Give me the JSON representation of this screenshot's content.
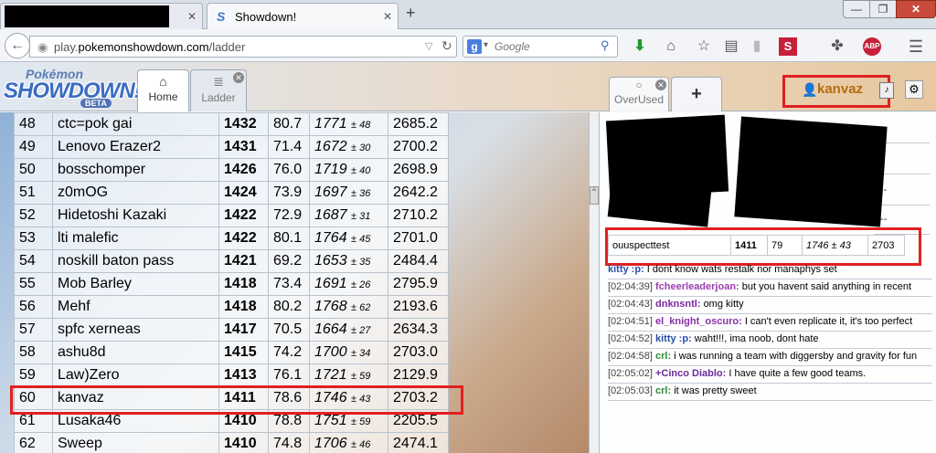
{
  "browser": {
    "tabs": [
      {
        "title": "",
        "redacted": true
      },
      {
        "title": "Showdown!",
        "active": true
      }
    ],
    "new_tab_icon": "+",
    "url_prefix": "play.",
    "url_domain": "pokemonshowdown.com",
    "url_path": "/ladder",
    "search_placeholder": "Google",
    "toolbar_icons": [
      "download-icon",
      "home-icon",
      "bookmark-star-icon",
      "reading-list-icon",
      "stats-icon",
      "s-extension-icon",
      "extensions-icon",
      "adblock-icon",
      "menu-icon"
    ]
  },
  "header": {
    "logo_top": "Pokémon",
    "logo_main": "SHOWDOWN!",
    "logo_beta": "BETA",
    "tabs": [
      {
        "label": "Home",
        "icon": "home-icon"
      },
      {
        "label": "Ladder",
        "icon": "ladder-icon"
      },
      {
        "label": "OverUsed",
        "icon": "chat-bubble-icon"
      }
    ],
    "plus": "+",
    "username": "kanvaz"
  },
  "ladder": {
    "rows": [
      {
        "rank": "48",
        "name": "ctc=pok gai",
        "elo": "1432",
        "gxe": "80.7",
        "glicko": "1771",
        "dev": "± 48",
        "cove": "2685.2"
      },
      {
        "rank": "49",
        "name": "Lenovo Erazer2",
        "elo": "1431",
        "gxe": "71.4",
        "glicko": "1672",
        "dev": "± 30",
        "cove": "2700.2"
      },
      {
        "rank": "50",
        "name": "bosschomper",
        "elo": "1426",
        "gxe": "76.0",
        "glicko": "1719",
        "dev": "± 40",
        "cove": "2698.9"
      },
      {
        "rank": "51",
        "name": "z0mOG",
        "elo": "1424",
        "gxe": "73.9",
        "glicko": "1697",
        "dev": "± 36",
        "cove": "2642.2"
      },
      {
        "rank": "52",
        "name": "Hidetoshi Kazaki",
        "elo": "1422",
        "gxe": "72.9",
        "glicko": "1687",
        "dev": "± 31",
        "cove": "2710.2"
      },
      {
        "rank": "53",
        "name": "lti malefic",
        "elo": "1422",
        "gxe": "80.1",
        "glicko": "1764",
        "dev": "± 45",
        "cove": "2701.0"
      },
      {
        "rank": "54",
        "name": "noskill baton pass",
        "elo": "1421",
        "gxe": "69.2",
        "glicko": "1653",
        "dev": "± 35",
        "cove": "2484.4"
      },
      {
        "rank": "55",
        "name": "Mob Barley",
        "elo": "1418",
        "gxe": "73.4",
        "glicko": "1691",
        "dev": "± 26",
        "cove": "2795.9"
      },
      {
        "rank": "56",
        "name": "Mehf",
        "elo": "1418",
        "gxe": "80.2",
        "glicko": "1768",
        "dev": "± 62",
        "cove": "2193.6"
      },
      {
        "rank": "57",
        "name": "spfc xerneas",
        "elo": "1417",
        "gxe": "70.5",
        "glicko": "1664",
        "dev": "± 27",
        "cove": "2634.3"
      },
      {
        "rank": "58",
        "name": "ashu8d",
        "elo": "1415",
        "gxe": "74.2",
        "glicko": "1700",
        "dev": "± 34",
        "cove": "2703.0"
      },
      {
        "rank": "59",
        "name": "Law)Zero",
        "elo": "1413",
        "gxe": "76.1",
        "glicko": "1721",
        "dev": "± 59",
        "cove": "2129.9"
      },
      {
        "rank": "60",
        "name": "kanvaz",
        "elo": "1411",
        "gxe": "78.6",
        "glicko": "1746",
        "dev": "± 43",
        "cove": "2703.2"
      },
      {
        "rank": "61",
        "name": "Lusaka46",
        "elo": "1410",
        "gxe": "78.8",
        "glicko": "1751",
        "dev": "± 59",
        "cove": "2205.5"
      },
      {
        "rank": "62",
        "name": "Sweep",
        "elo": "1410",
        "gxe": "74.8",
        "glicko": "1706",
        "dev": "± 46",
        "cove": "2474.1"
      }
    ]
  },
  "chat": {
    "mini_grid": [
      "",
      "",
      "",
      "--",
      "--"
    ],
    "mini_row": {
      "name": "ouuspecttest",
      "elo": "1411",
      "gxe": "79",
      "glicko": "1746",
      "dev": "± 43",
      "cove": "2703"
    },
    "messages": [
      {
        "time": "",
        "user": "kitty :p:",
        "text": "I dont know wats restalk nor manaphys set",
        "color": "#2a4fa8"
      },
      {
        "time": "[02:04:39]",
        "user": "fcheerleaderjoan:",
        "text": "but you havent said anything in recent",
        "color": "#9a3fb0"
      },
      {
        "time": "[02:04:43]",
        "user": "dnknsntl:",
        "text": "omg kitty",
        "color": "#7a2aa0"
      },
      {
        "time": "[02:04:51]",
        "user": "el_knight_oscuro:",
        "text": "I can't even replicate it, it's too perfect",
        "color": "#8a2fa8"
      },
      {
        "time": "[02:04:52]",
        "user": "kitty :p:",
        "text": "waht!!!, ima noob, dont hate",
        "color": "#2a4fa8"
      },
      {
        "time": "[02:04:58]",
        "user": "crl:",
        "text": "i was running a team with diggersby and gravity for fun",
        "color": "#2b8a3a"
      },
      {
        "time": "[02:05:02]",
        "user": "+Cinco Diablo:",
        "text": "I have quite a few good teams.",
        "color": "#6a2a9a"
      },
      {
        "time": "[02:05:03]",
        "user": "crl:",
        "text": "it was pretty sweet",
        "color": "#2b8a3a"
      }
    ]
  }
}
